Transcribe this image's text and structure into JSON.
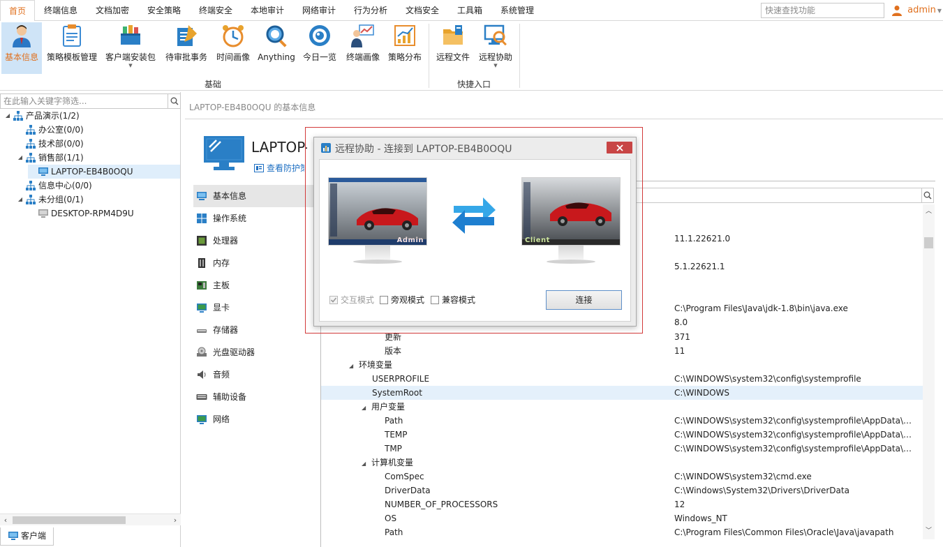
{
  "menu": [
    {
      "label": "首页"
    },
    {
      "label": "终端信息"
    },
    {
      "label": "文档加密"
    },
    {
      "label": "安全策略"
    },
    {
      "label": "终端安全"
    },
    {
      "label": "本地审计"
    },
    {
      "label": "网络审计"
    },
    {
      "label": "行为分析"
    },
    {
      "label": "文档安全"
    },
    {
      "label": "工具箱"
    },
    {
      "label": "系统管理"
    }
  ],
  "search": {
    "placeholder": "快速查找功能"
  },
  "user": {
    "name": "admin"
  },
  "ribbon": {
    "buttons": [
      {
        "label": "基本信息"
      },
      {
        "label": "策略模板管理"
      },
      {
        "label": "客户端安装包"
      },
      {
        "label": "待审批事务"
      },
      {
        "label": "时间画像"
      },
      {
        "label": "Anything"
      },
      {
        "label": "今日一览"
      },
      {
        "label": "终端画像"
      },
      {
        "label": "策略分布"
      },
      {
        "label": "远程文件"
      },
      {
        "label": "远程协助"
      }
    ],
    "groups": [
      {
        "label": "基础"
      },
      {
        "label": "快捷入口"
      }
    ]
  },
  "tree": {
    "filter_placeholder": "在此输入关键字筛选...",
    "nodes": [
      {
        "label": "产品演示(1/2)"
      },
      {
        "label": "办公室(0/0)"
      },
      {
        "label": "技术部(0/0)"
      },
      {
        "label": "销售部(1/1)"
      },
      {
        "label": "LAPTOP-EB4B0OQU"
      },
      {
        "label": "信息中心(0/0)"
      },
      {
        "label": "未分组(0/1)"
      },
      {
        "label": "DESKTOP-RPM4D9U"
      }
    ],
    "bottom_tab": "客户端"
  },
  "main": {
    "breadcrumb": "LAPTOP-EB4B0OQU 的基本信息",
    "device_title": "LAPTOP-EB4B0OQU",
    "view_policy_link": "查看防护策略",
    "nav": [
      {
        "label": "基本信息"
      },
      {
        "label": "操作系统"
      },
      {
        "label": "处理器"
      },
      {
        "label": "内存"
      },
      {
        "label": "主板"
      },
      {
        "label": "显卡"
      },
      {
        "label": "存储器"
      },
      {
        "label": "光盘驱动器"
      },
      {
        "label": "音频"
      },
      {
        "label": "辅助设备"
      },
      {
        "label": "网络"
      }
    ],
    "lone_values": [
      "11.1.22621.0",
      "5.1.22621.1",
      "C:\\Program Files\\Java\\jdk-1.8\\bin\\java.exe",
      "8.0"
    ],
    "rows": [
      {
        "key": "更新",
        "value": "371"
      },
      {
        "key": "版本",
        "value": "11"
      },
      {
        "key": "环境变量",
        "value": ""
      },
      {
        "key": "USERPROFILE",
        "value": "C:\\WINDOWS\\system32\\config\\systemprofile"
      },
      {
        "key": "SystemRoot",
        "value": "C:\\WINDOWS"
      },
      {
        "key": "用户变量",
        "value": ""
      },
      {
        "key": "Path",
        "value": "C:\\WINDOWS\\system32\\config\\systemprofile\\AppData\\L..."
      },
      {
        "key": "TEMP",
        "value": "C:\\WINDOWS\\system32\\config\\systemprofile\\AppData\\L..."
      },
      {
        "key": "TMP",
        "value": "C:\\WINDOWS\\system32\\config\\systemprofile\\AppData\\L..."
      },
      {
        "key": "计算机变量",
        "value": ""
      },
      {
        "key": "ComSpec",
        "value": "C:\\WINDOWS\\system32\\cmd.exe"
      },
      {
        "key": "DriverData",
        "value": "C:\\Windows\\System32\\Drivers\\DriverData"
      },
      {
        "key": "NUMBER_OF_PROCESSORS",
        "value": "12"
      },
      {
        "key": "OS",
        "value": "Windows_NT"
      },
      {
        "key": "Path",
        "value": "C:\\Program Files\\Common Files\\Oracle\\Java\\javapath"
      }
    ]
  },
  "dialog": {
    "title": "远程协助 - 连接到 LAPTOP-EB4B0OQU",
    "admin_label": "Admin",
    "client_label": "Client",
    "options": [
      {
        "label": "交互模式",
        "checked": true,
        "disabled": true
      },
      {
        "label": "旁观模式",
        "checked": false,
        "disabled": false
      },
      {
        "label": "兼容模式",
        "checked": false,
        "disabled": false
      }
    ],
    "connect_label": "连接"
  },
  "colors": {
    "accent": "#e0701e",
    "link": "#1e6fc2",
    "selection": "#cfe4f7",
    "close": "#c84545",
    "highlight_frame": "#d23a3a"
  }
}
